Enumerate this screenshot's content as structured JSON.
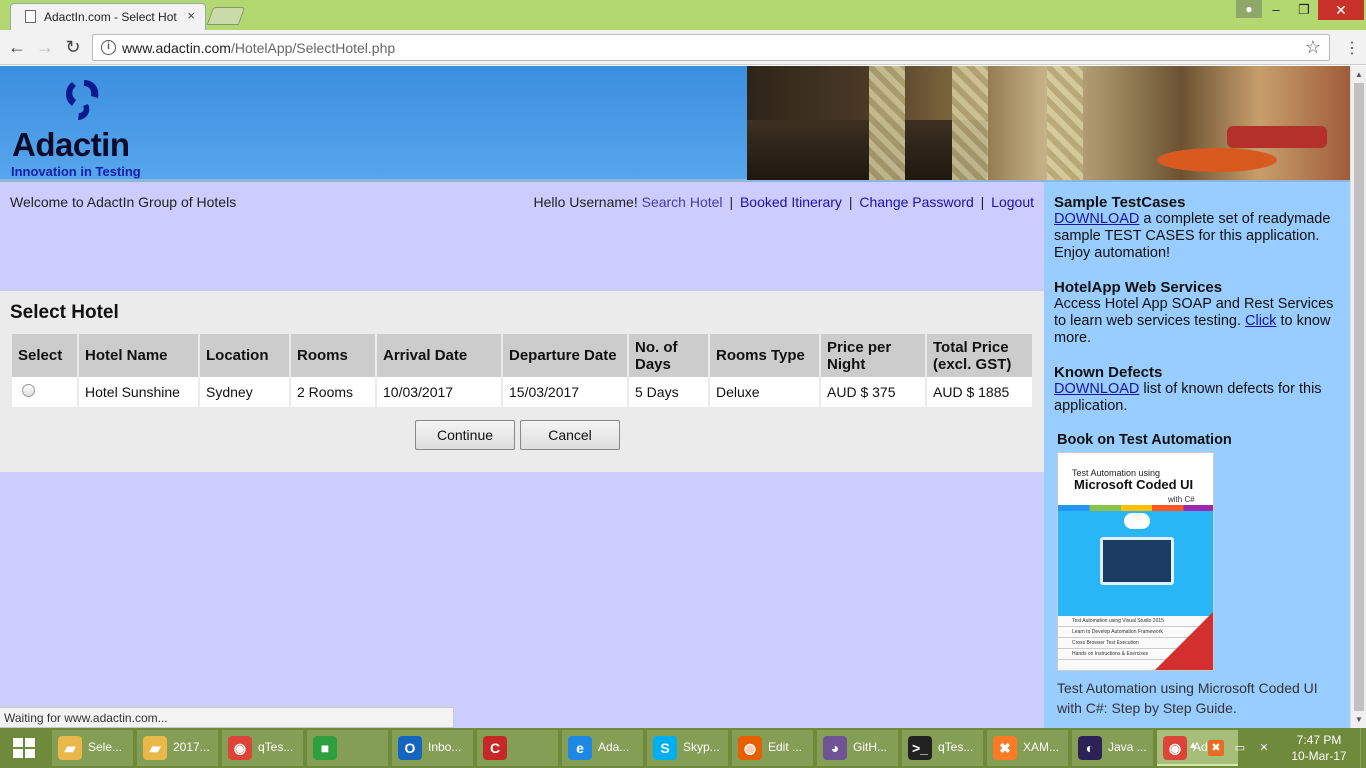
{
  "browser": {
    "tab_title": "AdactIn.com - Select Hot",
    "tab_close": "×",
    "url_host": "www.adactin.com",
    "url_path": "/HotelApp/SelectHotel.php",
    "window_controls": {
      "minimize": "–",
      "restore": "❐",
      "close": "✕"
    },
    "nav": {
      "back": "←",
      "forward": "→",
      "reload": "↻"
    },
    "star": "☆",
    "menu": "⋮"
  },
  "header": {
    "logo_text": "Adactin",
    "logo_tagline": "Innovation in Testing"
  },
  "topbar": {
    "welcome": "Welcome to AdactIn Group of Hotels",
    "greeting": "Hello Username!",
    "links": [
      "Search Hotel",
      "Booked Itinerary",
      "Change Password",
      "Logout"
    ],
    "separator": "|"
  },
  "select_hotel": {
    "title": "Select Hotel",
    "columns": [
      "Select",
      "Hotel Name",
      "Location",
      "Rooms",
      "Arrival Date",
      "Departure Date",
      "No. of Days",
      "Rooms Type",
      "Price per Night",
      "Total Price (excl. GST)"
    ],
    "rows": [
      {
        "hotel_name": "Hotel Sunshine",
        "location": "Sydney",
        "rooms": "2 Rooms",
        "arrival": "10/03/2017",
        "departure": "15/03/2017",
        "days": "5 Days",
        "room_type": "Deluxe",
        "price_per_night": "AUD $ 375",
        "total_price": "AUD $ 1885"
      }
    ],
    "continue_label": "Continue",
    "cancel_label": "Cancel"
  },
  "sidebar": {
    "testcases_heading": "Sample TestCases",
    "testcases_link": "DOWNLOAD",
    "testcases_text": " a complete set of readymade sample TEST CASES for this application. Enjoy automation!",
    "webservices_heading": "HotelApp Web Services",
    "webservices_text": "Access Hotel App SOAP and Rest Services to learn web services testing. ",
    "webservices_link": "Click",
    "webservices_text2": " to know more.",
    "defects_heading": "Known Defects",
    "defects_link": "DOWNLOAD",
    "defects_text": " list of known defects for this application.",
    "book_heading": "Book on Test Automation",
    "book_cover_line1": "Test Automation using",
    "book_cover_line2": "Microsoft Coded UI",
    "book_cover_line3": "with C#",
    "book_cover_bullets": [
      "Test Automation using Visual Studio 2015",
      "Learn to Develop Automation Framework",
      "Cross Browser Test Execution",
      "Hands on Instructions & Exercises"
    ],
    "book_caption": "Test Automation using Microsoft Coded UI with C#: Step by Step Guide."
  },
  "status_text": "Waiting for www.adactin.com...",
  "taskbar": {
    "items": [
      {
        "label": "Sele...",
        "icon": "folder-icon",
        "color": "#e8b84a"
      },
      {
        "label": "2017...",
        "icon": "folder-icon",
        "color": "#e8b84a"
      },
      {
        "label": "qTes...",
        "icon": "chrome-icon",
        "color": "#db4437"
      },
      {
        "label": "",
        "icon": "store-icon",
        "color": "#2e9e3e"
      },
      {
        "label": "Inbo...",
        "icon": "outlook-icon",
        "color": "#1565c0"
      },
      {
        "label": "",
        "icon": "ccleaner-icon",
        "color": "#c62828"
      },
      {
        "label": "Ada...",
        "icon": "ie-icon",
        "color": "#1e88e5"
      },
      {
        "label": "Skyp...",
        "icon": "skype-icon",
        "color": "#00aff0"
      },
      {
        "label": "Edit ...",
        "icon": "firefox-icon",
        "color": "#e66000"
      },
      {
        "label": "GitH...",
        "icon": "github-icon",
        "color": "#6e5494"
      },
      {
        "label": "qTes...",
        "icon": "cmd-icon",
        "color": "#222222"
      },
      {
        "label": "XAM...",
        "icon": "xampp-icon",
        "color": "#fb7a24"
      },
      {
        "label": "Java ...",
        "icon": "eclipse-icon",
        "color": "#2c2255"
      },
      {
        "label": "Ada...",
        "icon": "chrome-icon",
        "color": "#db4437"
      }
    ],
    "clock_time": "7:47 PM",
    "clock_date": "10-Mar-17",
    "tray_arrow": "▲"
  },
  "colors": {
    "page_bg": "#ccccff",
    "sidebar_bg": "#99ccff",
    "header_blue": "#3b8ee0",
    "link": "#1a12a8",
    "taskbar": "#6e8a3a",
    "titlebar": "#b4d871"
  }
}
